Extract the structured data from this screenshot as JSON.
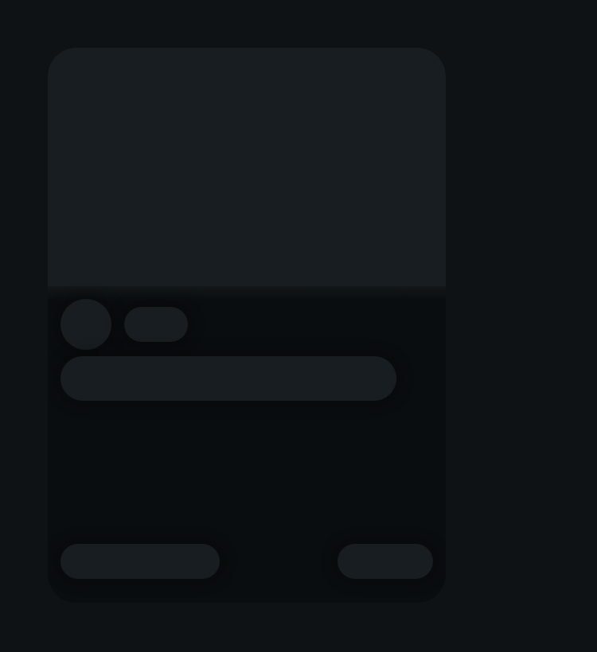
{
  "card": {
    "state": "loading-skeleton"
  },
  "colors": {
    "page_background": "#0e1215",
    "card_background": "#0a0d0f",
    "placeholder": "#171d20"
  }
}
